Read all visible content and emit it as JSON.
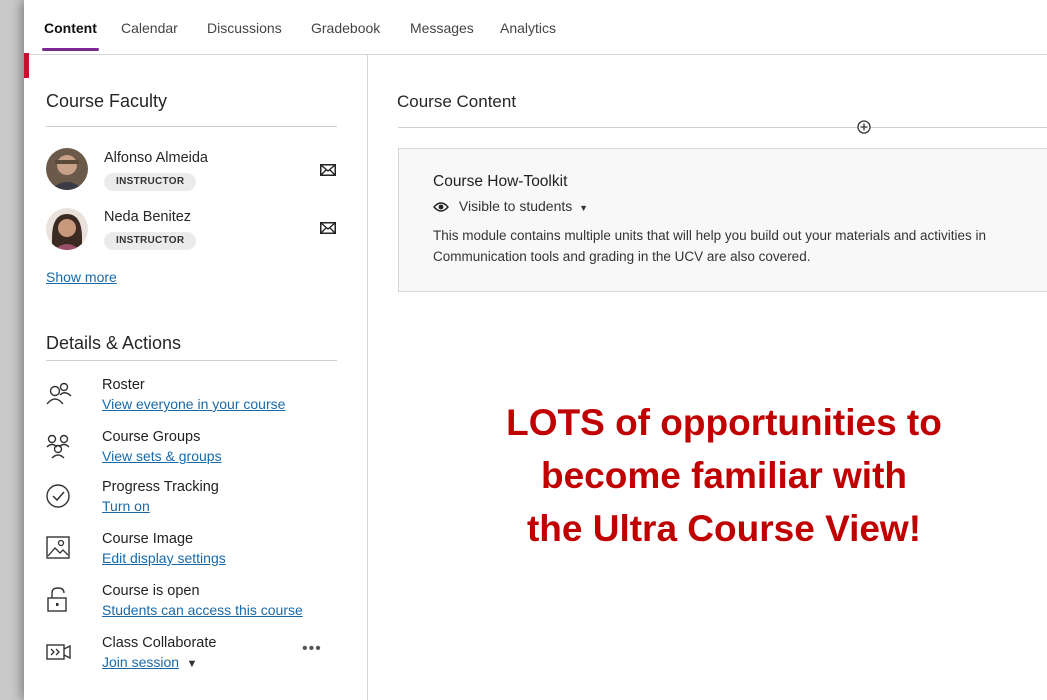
{
  "nav": {
    "tabs": [
      {
        "label": "Content",
        "active": true
      },
      {
        "label": "Calendar"
      },
      {
        "label": "Discussions"
      },
      {
        "label": "Gradebook"
      },
      {
        "label": "Messages"
      },
      {
        "label": "Analytics"
      }
    ]
  },
  "faculty": {
    "title": "Course Faculty",
    "members": [
      {
        "name": "Alfonso Almeida",
        "role": "INSTRUCTOR"
      },
      {
        "name": "Neda Benitez",
        "role": "INSTRUCTOR"
      }
    ],
    "show_more": "Show more"
  },
  "details": {
    "title": "Details & Actions",
    "items": [
      {
        "title": "Roster",
        "link": "View everyone in your course",
        "icon": "roster-icon"
      },
      {
        "title": "Course Groups",
        "link": "View sets & groups",
        "icon": "groups-icon"
      },
      {
        "title": "Progress Tracking",
        "link": "Turn on",
        "icon": "check-circle-icon"
      },
      {
        "title": "Course Image",
        "link": "Edit display settings",
        "icon": "image-icon"
      },
      {
        "title": "Course is open",
        "link": "Students can access this course",
        "icon": "unlock-icon"
      },
      {
        "title": "Class Collaborate",
        "link": "Join session",
        "icon": "collaborate-icon"
      }
    ]
  },
  "content": {
    "title": "Course Content",
    "module": {
      "title": "Course How-Toolkit",
      "visibility": "Visible to students",
      "description_line1": "This module contains multiple units that will help you build out your materials and activities in",
      "description_line2": "Communication tools and grading in the UCV are also covered."
    }
  },
  "overlay": {
    "line1": "LOTS of opportunities to",
    "line2": "become familiar with",
    "line3": "the Ultra Course View!"
  },
  "colors": {
    "accent_red": "#c4122f",
    "active_tab_underline": "#7b2a8f",
    "link": "#1a6aa8",
    "headline": "#c00000"
  }
}
